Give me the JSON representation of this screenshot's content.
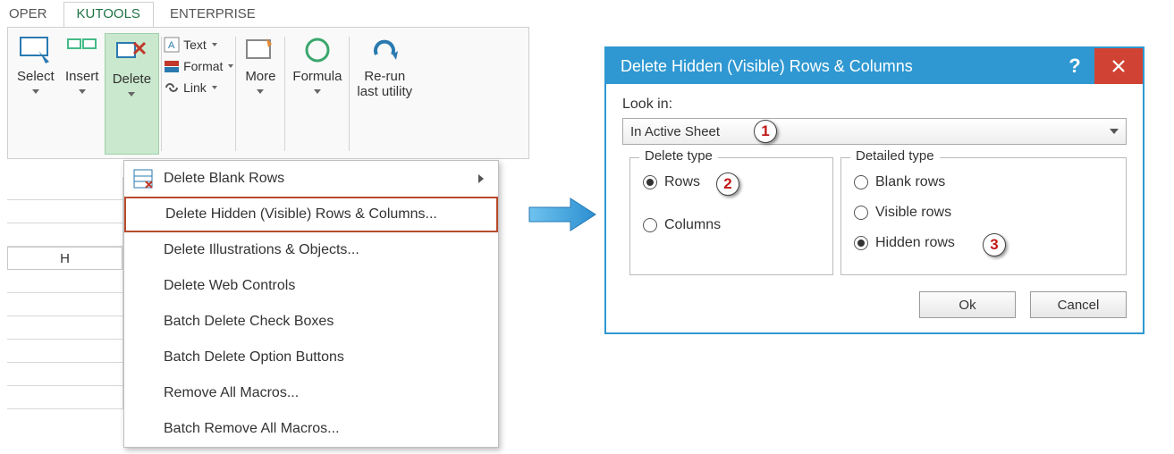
{
  "tabs": {
    "partial": "OPER",
    "active": "KUTOOLS",
    "other": "ENTERPRISE"
  },
  "ribbon": {
    "select": "Select",
    "insert": "Insert",
    "delete": "Delete",
    "text": "Text",
    "format": "Format",
    "link": "Link",
    "more": "More",
    "formula": "Formula",
    "rerun_line1": "Re-run",
    "rerun_line2": "last utility"
  },
  "column_h": "H",
  "menu": {
    "items": [
      "Delete Blank Rows",
      "Delete Hidden (Visible) Rows & Columns...",
      "Delete Illustrations & Objects...",
      "Delete Web Controls",
      "Batch Delete Check Boxes",
      "Batch Delete Option Buttons",
      "Remove All Macros...",
      "Batch Remove All Macros..."
    ]
  },
  "dialog": {
    "title": "Delete Hidden (Visible) Rows & Columns",
    "look_in_label": "Look in:",
    "look_in_value": "In Active Sheet",
    "delete_type_legend": "Delete type",
    "rows": "Rows",
    "columns": "Columns",
    "detailed_legend": "Detailed type",
    "blank": "Blank rows",
    "visible": "Visible rows",
    "hidden": "Hidden rows",
    "ok": "Ok",
    "cancel": "Cancel"
  },
  "badges": {
    "b1": "1",
    "b2": "2",
    "b3": "3"
  }
}
